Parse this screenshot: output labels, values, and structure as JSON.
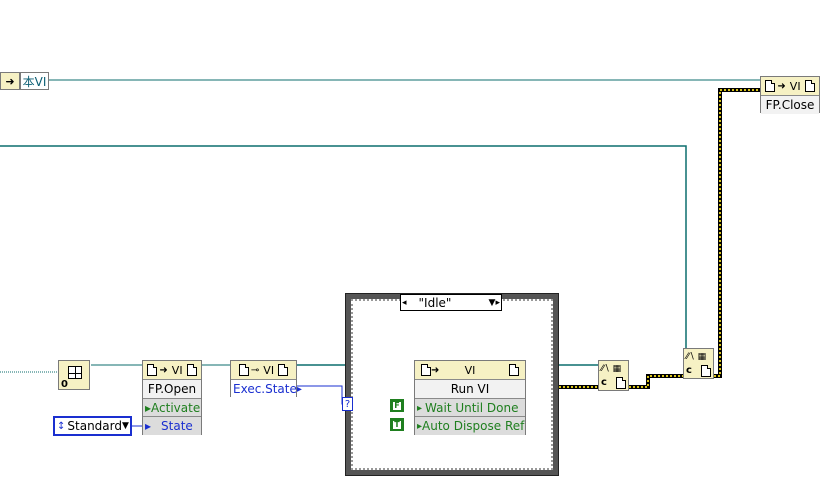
{
  "this_vi": {
    "label": "本VI"
  },
  "fp_close": {
    "class": "VI",
    "method": "FP.Close"
  },
  "fp_open": {
    "class": "VI",
    "method": "FP.Open",
    "params": [
      "Activate",
      "State"
    ]
  },
  "exec_state": {
    "class": "VI",
    "property": "Exec.State"
  },
  "state_enum": {
    "value": "Standard"
  },
  "case_structure": {
    "selector": "\"Idle\""
  },
  "run_vi": {
    "class": "VI",
    "method": "Run VI",
    "params": [
      "Wait Until Done",
      "Auto Dispose Ref"
    ]
  },
  "bool_false": {
    "label": "F"
  },
  "bool_true": {
    "label": "T"
  },
  "icons": [
    "arrow-right-icon",
    "document-icon",
    "key-icon",
    "close-reference-icon",
    "window-icon"
  ],
  "colors": {
    "reference_wire": "#0c6e6e",
    "error_wire": "#d8c41c",
    "node_header": "#f6f1c4",
    "bool_constant": "#1f7f1f",
    "enum": "#1a2fd0"
  }
}
